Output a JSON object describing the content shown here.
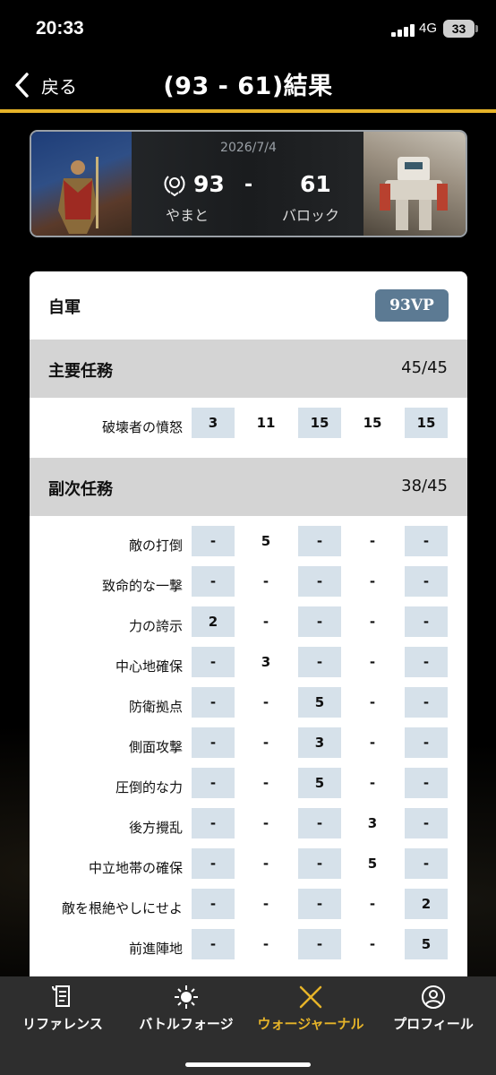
{
  "status_bar": {
    "time": "20:33",
    "network": "4G",
    "battery": "33"
  },
  "nav": {
    "back_label": "戻る",
    "title": "(93 - 61)結果"
  },
  "match": {
    "date": "2026/7/4",
    "player_a": {
      "name": "やまと",
      "score": "93"
    },
    "separator": "-",
    "player_b": {
      "name": "バロック",
      "score": "61"
    }
  },
  "card": {
    "title": "自軍",
    "vp": "93VP",
    "primary": {
      "title": "主要任務",
      "score": "45/45",
      "rows": [
        {
          "label": "破壊者の憤怒",
          "values": [
            "3",
            "11",
            "15",
            "15",
            "15"
          ]
        }
      ]
    },
    "secondary": {
      "title": "副次任務",
      "score": "38/45",
      "rows": [
        {
          "label": "敵の打倒",
          "values": [
            "-",
            "5",
            "-",
            "-",
            "-"
          ]
        },
        {
          "label": "致命的な一撃",
          "values": [
            "-",
            "-",
            "-",
            "-",
            "-"
          ]
        },
        {
          "label": "力の誇示",
          "values": [
            "2",
            "-",
            "-",
            "-",
            "-"
          ]
        },
        {
          "label": "中心地確保",
          "values": [
            "-",
            "3",
            "-",
            "-",
            "-"
          ]
        },
        {
          "label": "防衛拠点",
          "values": [
            "-",
            "-",
            "5",
            "-",
            "-"
          ]
        },
        {
          "label": "側面攻撃",
          "values": [
            "-",
            "-",
            "3",
            "-",
            "-"
          ]
        },
        {
          "label": "圧倒的な力",
          "values": [
            "-",
            "-",
            "5",
            "-",
            "-"
          ]
        },
        {
          "label": "後方攪乱",
          "values": [
            "-",
            "-",
            "-",
            "3",
            "-"
          ]
        },
        {
          "label": "中立地帯の確保",
          "values": [
            "-",
            "-",
            "-",
            "5",
            "-"
          ]
        },
        {
          "label": "敵を根絶やしにせよ",
          "values": [
            "-",
            "-",
            "-",
            "-",
            "2"
          ]
        },
        {
          "label": "前進陣地",
          "values": [
            "-",
            "-",
            "-",
            "-",
            "5"
          ]
        }
      ]
    }
  },
  "tabs": [
    {
      "label": "リファレンス",
      "icon": "scroll-icon",
      "active": false
    },
    {
      "label": "バトルフォージ",
      "icon": "forge-icon",
      "active": false
    },
    {
      "label": "ウォージャーナル",
      "icon": "crossed-swords-icon",
      "active": true
    },
    {
      "label": "プロフィール",
      "icon": "profile-icon",
      "active": false
    }
  ],
  "colors": {
    "accent": "#e6b429",
    "vp_badge": "#5c7a93",
    "shaded_cell": "#d6e1ea",
    "section_bg": "#d4d4d4"
  }
}
